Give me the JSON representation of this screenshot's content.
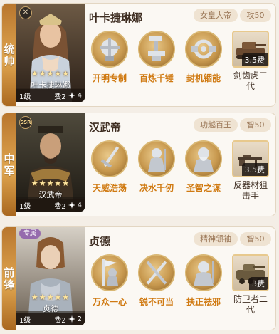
{
  "cards": [
    {
      "role": "统帅",
      "badge": "✕",
      "tag": "",
      "hero_name": "叶卡捷琳娜",
      "stars": "★★★★★",
      "level": "1级",
      "cost": "费2",
      "troops": "4",
      "title": "女皇大帝",
      "stat": "攻50",
      "skills": [
        "开明专制",
        "百炼千锤",
        "封机锢能"
      ],
      "tactic": {
        "fee": "3.5费",
        "name": "剑齿虎二代"
      }
    },
    {
      "role": "中军",
      "badge": "SSR",
      "tag": "",
      "hero_name": "汉武帝",
      "stars": "★★★★★",
      "level": "1级",
      "cost": "费2",
      "troops": "4",
      "title": "功越百王",
      "stat": "智50",
      "skills": [
        "天威浩荡",
        "决水千仞",
        "圣智之谋"
      ],
      "tactic": {
        "fee": "3.5费",
        "name": "反器材狙击手"
      }
    },
    {
      "role": "前锋",
      "badge": "",
      "tag": "专属",
      "hero_name": "贞德",
      "stars": "★★★★★",
      "level": "1级",
      "cost": "费2",
      "troops": "2",
      "title": "精神领袖",
      "stat": "智50",
      "skills": [
        "万众一心",
        "锐不可当",
        "扶正祛邪"
      ],
      "tactic": {
        "fee": "3费",
        "name": "防卫者二代"
      }
    }
  ]
}
